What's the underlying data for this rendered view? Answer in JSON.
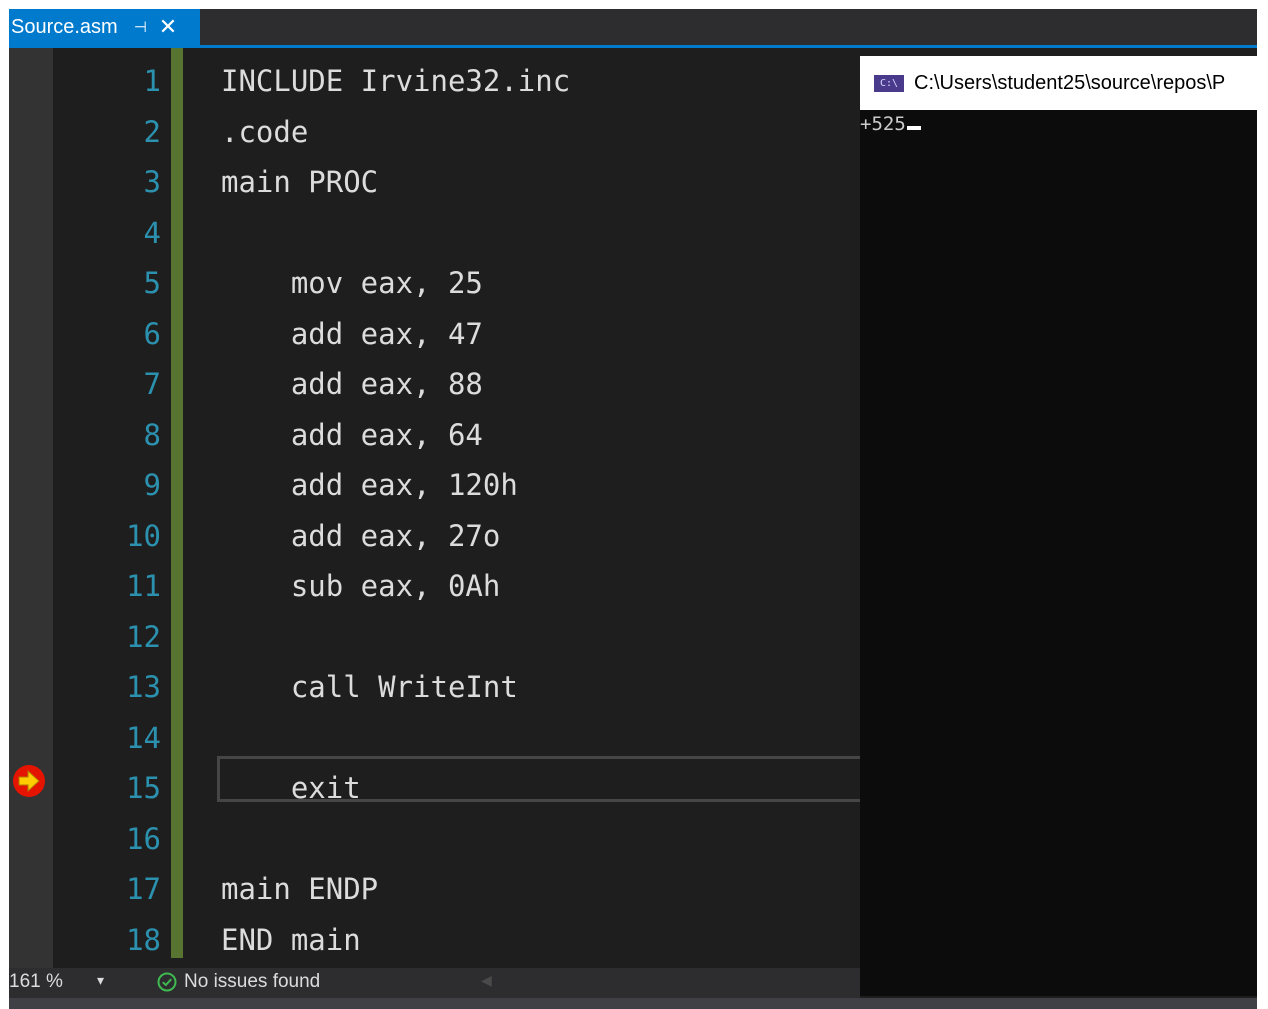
{
  "tab": {
    "title": "Source.asm",
    "pin_glyph": "⊣",
    "close_glyph": "✕"
  },
  "editor": {
    "lines": [
      {
        "num": "1",
        "text": "INCLUDE Irvine32.inc"
      },
      {
        "num": "2",
        "text": ".code"
      },
      {
        "num": "3",
        "text": "main PROC"
      },
      {
        "num": "4",
        "text": ""
      },
      {
        "num": "5",
        "text": "    mov eax, 25"
      },
      {
        "num": "6",
        "text": "    add eax, 47"
      },
      {
        "num": "7",
        "text": "    add eax, 88"
      },
      {
        "num": "8",
        "text": "    add eax, 64"
      },
      {
        "num": "9",
        "text": "    add eax, 120h"
      },
      {
        "num": "10",
        "text": "    add eax, 27o"
      },
      {
        "num": "11",
        "text": "    sub eax, 0Ah"
      },
      {
        "num": "12",
        "text": ""
      },
      {
        "num": "13",
        "text": "    call WriteInt"
      },
      {
        "num": "14",
        "text": ""
      },
      {
        "num": "15",
        "text": "    exit"
      },
      {
        "num": "16",
        "text": ""
      },
      {
        "num": "17",
        "text": "main ENDP"
      },
      {
        "num": "18",
        "text": "END main"
      }
    ],
    "current_line": 15
  },
  "status": {
    "zoom": "161 %",
    "dropdown_glyph": "▾",
    "issues": "No issues found"
  },
  "console": {
    "title": "C:\\Users\\student25\\source\\repos\\P",
    "icon_text": "C:\\",
    "output": "+525"
  },
  "colors": {
    "accent": "#007acc",
    "line_number": "#2b91af",
    "change_bar": "#577430",
    "breakpoint": "#e51400",
    "current_arrow": "#ffcc00"
  }
}
